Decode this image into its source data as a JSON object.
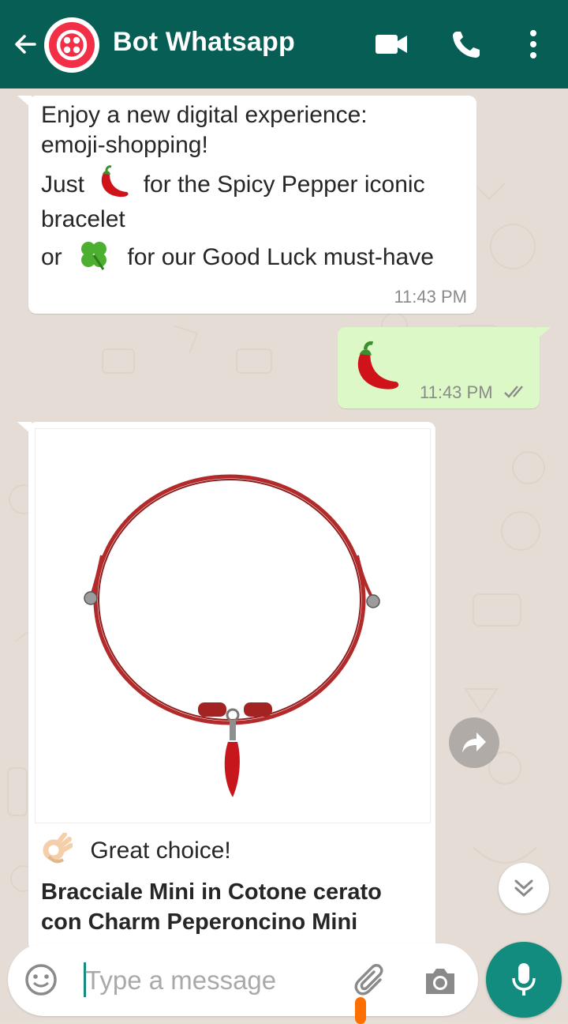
{
  "header": {
    "title": "Bot Whatsapp",
    "icons": [
      "back-arrow-icon",
      "twilio-logo",
      "video-call-icon",
      "phone-icon",
      "more-vertical-icon"
    ],
    "color": "#075e54"
  },
  "messages": [
    {
      "direction": "incoming",
      "lines": [
        "Enjoy a new digital experience:",
        "emoji-shopping!",
        "Just",
        "for the Spicy Pepper iconic",
        "bracelet",
        "or",
        "for our Good Luck must-have"
      ],
      "time": "11:43 PM"
    },
    {
      "direction": "outgoing",
      "emoji": "chili-pepper",
      "time": "11:43 PM",
      "status": "read"
    },
    {
      "direction": "incoming",
      "type": "product-card",
      "image": "red-cord-bracelet-with-chili-charm",
      "caption": "Great choice!",
      "product_title_line1": "Bracciale Mini in Cotone cerato",
      "product_title_line2": "con Charm Peperoncino Mini"
    }
  ],
  "input": {
    "placeholder": "Type a message",
    "icons": [
      "emoji-icon",
      "attach-icon",
      "camera-icon",
      "mic-icon"
    ]
  },
  "colors": {
    "outgoing_bubble": "#dcf8c6",
    "accent": "#128c7e",
    "read_ticks": "#8a8a8a"
  }
}
